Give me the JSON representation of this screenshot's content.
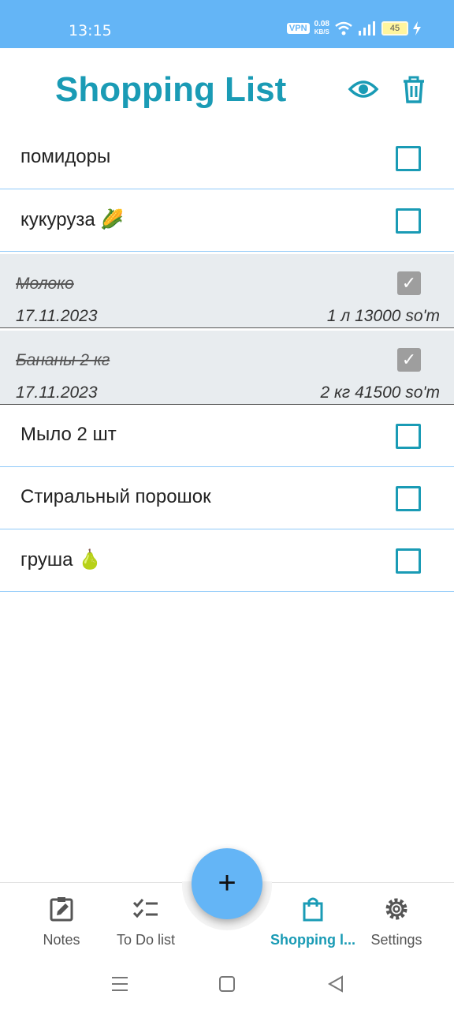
{
  "status_bar": {
    "time": "13:15",
    "vpn": "VPN",
    "net_speed": "0.08",
    "net_unit": "KB/S",
    "battery": "45"
  },
  "header": {
    "title": "Shopping List",
    "view_icon": "eye-icon",
    "delete_icon": "trash-icon"
  },
  "items": [
    {
      "name": "помидоры",
      "done": false
    },
    {
      "name": "кукуруза 🌽",
      "done": false
    },
    {
      "name": "Молоко",
      "done": true,
      "date": "17.11.2023",
      "price": "1 л 13000 so'm"
    },
    {
      "name": "Бананы 2 кг",
      "done": true,
      "date": "17.11.2023",
      "price": "2 кг 41500 so'm"
    },
    {
      "name": "Мыло 2 шт",
      "done": false
    },
    {
      "name": "Стиральный порошок",
      "done": false
    },
    {
      "name": "груша 🍐",
      "done": false
    }
  ],
  "fab": {
    "label": "+"
  },
  "bottom_nav": [
    {
      "label": "Notes",
      "icon": "note-edit-icon",
      "active": false
    },
    {
      "label": "To Do list",
      "icon": "checklist-icon",
      "active": false
    },
    {
      "label": "Shopping l...",
      "icon": "shopping-bag-icon",
      "active": true
    },
    {
      "label": "Settings",
      "icon": "gear-icon",
      "active": false
    }
  ],
  "colors": {
    "accent": "#1a9bb5",
    "status_bar": "#64b5f6",
    "fab": "#64b5f6",
    "done_row": "#e8ecef"
  }
}
